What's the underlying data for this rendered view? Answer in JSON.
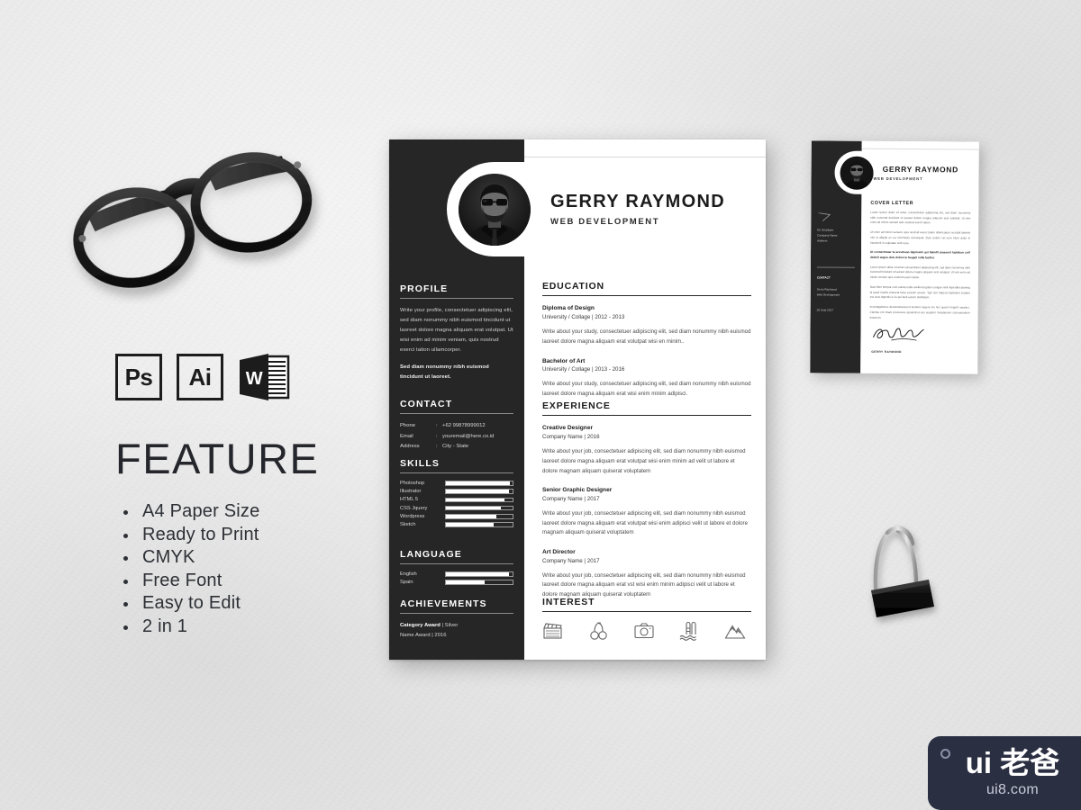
{
  "scene": {
    "background_color": "#e9e9e9",
    "description": "Resume template mockup presentation"
  },
  "promo": {
    "software_badges": [
      {
        "label": "Ps",
        "name": "photoshop"
      },
      {
        "label": "Ai",
        "name": "illustrator"
      },
      {
        "label": "W",
        "name": "word"
      }
    ],
    "feature_title": "FEATURE",
    "features": [
      "A4 Paper Size",
      "Ready to Print",
      "CMYK",
      "Free Font",
      "Easy to Edit",
      "2 in 1"
    ]
  },
  "resume": {
    "header": {
      "full_name": "GERRY RAYMOND",
      "job_title": "WEB DEVELOPMENT"
    },
    "profile": {
      "title": "PROFILE",
      "paragraph1": "Write your profile, consectetuer adipiscing elit, sed diam nonummy nibh euismod tincidunt ut laoreet dolore magna aliquam erat volutpat. Ut wisi enim ad minim veniam, quis nostrud exerci tation ullamcorper.",
      "paragraph2": "Sed diam nonummy nibh euismod tincidunt ut laoreet."
    },
    "contact": {
      "title": "CONTACT",
      "rows": [
        {
          "key": "Phone",
          "value": "+62 99878999012"
        },
        {
          "key": "Email",
          "value": "youremail@here.co.id"
        },
        {
          "key": "Address",
          "value": "City - State"
        }
      ]
    },
    "skills": {
      "title": "SKILLS",
      "items": [
        {
          "name": "Photoshop",
          "level": 96
        },
        {
          "name": "Illustrator",
          "level": 94
        },
        {
          "name": "HTML 5",
          "level": 88
        },
        {
          "name": "CSS Jquery",
          "level": 82
        },
        {
          "name": "Wordpress",
          "level": 76
        },
        {
          "name": "Sketch",
          "level": 72
        }
      ]
    },
    "language": {
      "title": "LANGUAGE",
      "items": [
        {
          "name": "English",
          "level": 95
        },
        {
          "name": "Spain",
          "level": 58
        }
      ]
    },
    "achievements": {
      "title": "ACHIEVEMENTS",
      "line1_bold": "Category Award",
      "line1_rest": " | Silver",
      "line2": "Name Award | 2016"
    },
    "education": {
      "title": "EDUCATION",
      "entries": [
        {
          "degree": "Diploma of Design",
          "school": "University / Collage  |  2012 - 2013",
          "description": "Write about your study, consectetuer adipiscing elit, sed diam nonummy nibh euismod laoreet dolore magna aliquam erat volutpat wisi en  minim.."
        },
        {
          "degree": "Bachelor of Art",
          "school": "University / Collage  |  2013 - 2016",
          "description": "Write about your study, consectetuer adipiscing elit, sed diam nonummy nibh euismod laoreet dolore magna aliquam erat  wisi enim minim adipisci."
        }
      ]
    },
    "experience": {
      "title": "EXPERIENCE",
      "entries": [
        {
          "role": "Creative Designer",
          "company": "Company Name  |  2016",
          "description": "Write about your job, consectetuer adipiscing elit, sed diam nonummy nibh euismod laoreet dolore magna aliquam erat volutpat wisi enim minim ad velit ut labore et dolore magnam aliquam quiserat voluptatem"
        },
        {
          "role": "Senior Graphic Designer",
          "company": "Company Name  |  2017",
          "description": "Write about your job, consectetuer adipiscing elit, sed diam nonummy nibh euismod laoreet dolore magna aliquam erat volutpat wisi enim adipisci velit ut labore et dolore magnam aliquam quiserat voluptatem"
        },
        {
          "role": "Art Director",
          "company": "Company Name  |  2017",
          "description": "Write about your job, consectetuer adipiscing elit, sed diam nonummy nibh euismod laoreet dolore magna aliquam erat vst wisi enim minim adipisci velit ut labore et dolore magnam aliquam quiserat voluptatem"
        }
      ]
    },
    "interest": {
      "title": "INTEREST",
      "icons": [
        "movie-clapperboard-icon",
        "dumbbell-icon",
        "camera-icon",
        "swimming-pool-icon",
        "mountain-hiking-icon"
      ]
    }
  },
  "cover_letter": {
    "header": {
      "full_name": "GERRY RAYMOND",
      "job_title": "WEB DEVELOPMENT"
    },
    "section_title": "COVER LETTER",
    "sidebar": {
      "address_block": "Mr. Employer\nCompany Name\nAddress",
      "contact_label": "CONTACT",
      "contact_block": "Gerry Raymond\nWeb Development",
      "date": "20 Sept 2017"
    },
    "paragraphs": [
      "Lorem ipsum dolor sit amet, consectetuer adipiscing elit, sed diam nonummy nibh euismod tincidunt ut laoreet dolore magna aliquam erat volutpat. Ut wisi enim ad minim veniam quis nostrud exerci tation.",
      "Ut enim ad minim veniam, quis nostrud exerci tation ullamcorper suscipit lobortis nisl ut aliquip ex ea commodo consequat. Duis autem vel eum iriure dolor in hendrerit in vulputate velit esse.",
      "Ut consectetuer te accumsan dignissim qui blandit praesent luptatum zzril delenit augue duis dolore te feugait nulla facilisi.",
      "Lorem ipsum dolor sit amet consectetuer adipiscing elit, sed diam nonummy nibh euismod tincidunt ut laoreet dolore magna aliquam erat volutpat. Ut wisi enim ad minim veniam quis nostrud exerci tation.",
      "Nam liber tempor cum soluta nobis eleifend option congue nihil imperdiet doming id quod mazim placerat facer possim assum. Typi non habent claritatem insitam est usus legentis in iis qui facit eorum claritatem.",
      "Investigationes demonstraverunt lectores legere me lius quod ii legunt saepius. Claritas est etiam processus dynamicus qui sequitur mutationem consuetudium lectorum."
    ],
    "signature_name": "GERRY RAYMOND"
  },
  "watermark": {
    "main": "ui 老爸",
    "sub": "ui8.com",
    "background": "#2b2f42"
  }
}
